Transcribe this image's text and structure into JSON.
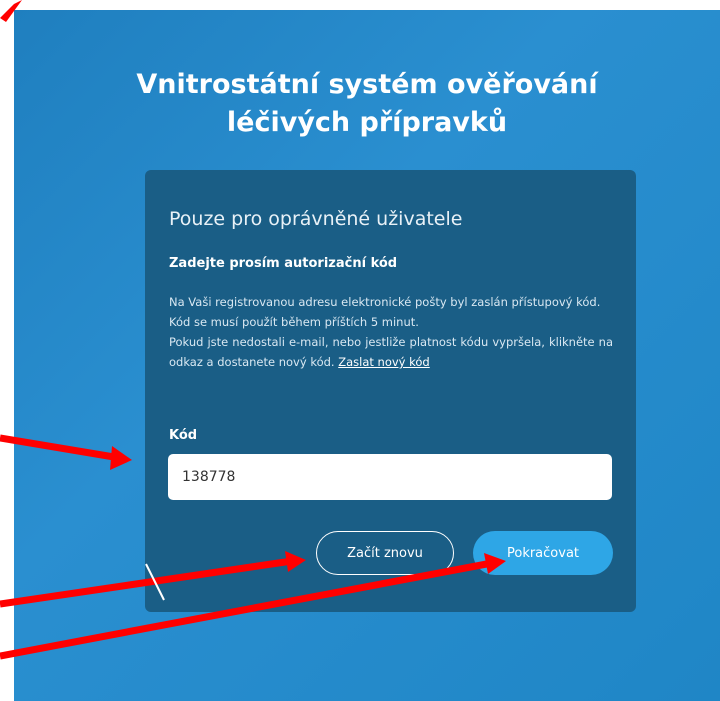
{
  "header": {
    "title_line1": "Vnitrostátní systém ověřování",
    "title_line2": "léčivých přípravků"
  },
  "card": {
    "heading": "Pouze pro oprávněné uživatele",
    "subheading": "Zadejte prosím autorizační kód",
    "info_line1": "Na Vaši registrovanou adresu elektronické pošty byl zaslán přístupový kód.",
    "info_line2": "Kód se musí použít během příštích 5 minut.",
    "info_line3": "Pokud jste nedostali e-mail, nebo jestliže platnost kódu vypršela, klikněte na odkaz a dostanete nový kód.",
    "resend_link": "Zaslat nový kód",
    "code_label": "Kód",
    "code_value": "138778",
    "restart_button": "Začít znovu",
    "continue_button": "Pokračovat"
  },
  "colors": {
    "background": "#2a8fd0",
    "panel": "#1a5e86",
    "primary_button": "#2ea6e6",
    "annotation_arrow": "#ff0000"
  }
}
